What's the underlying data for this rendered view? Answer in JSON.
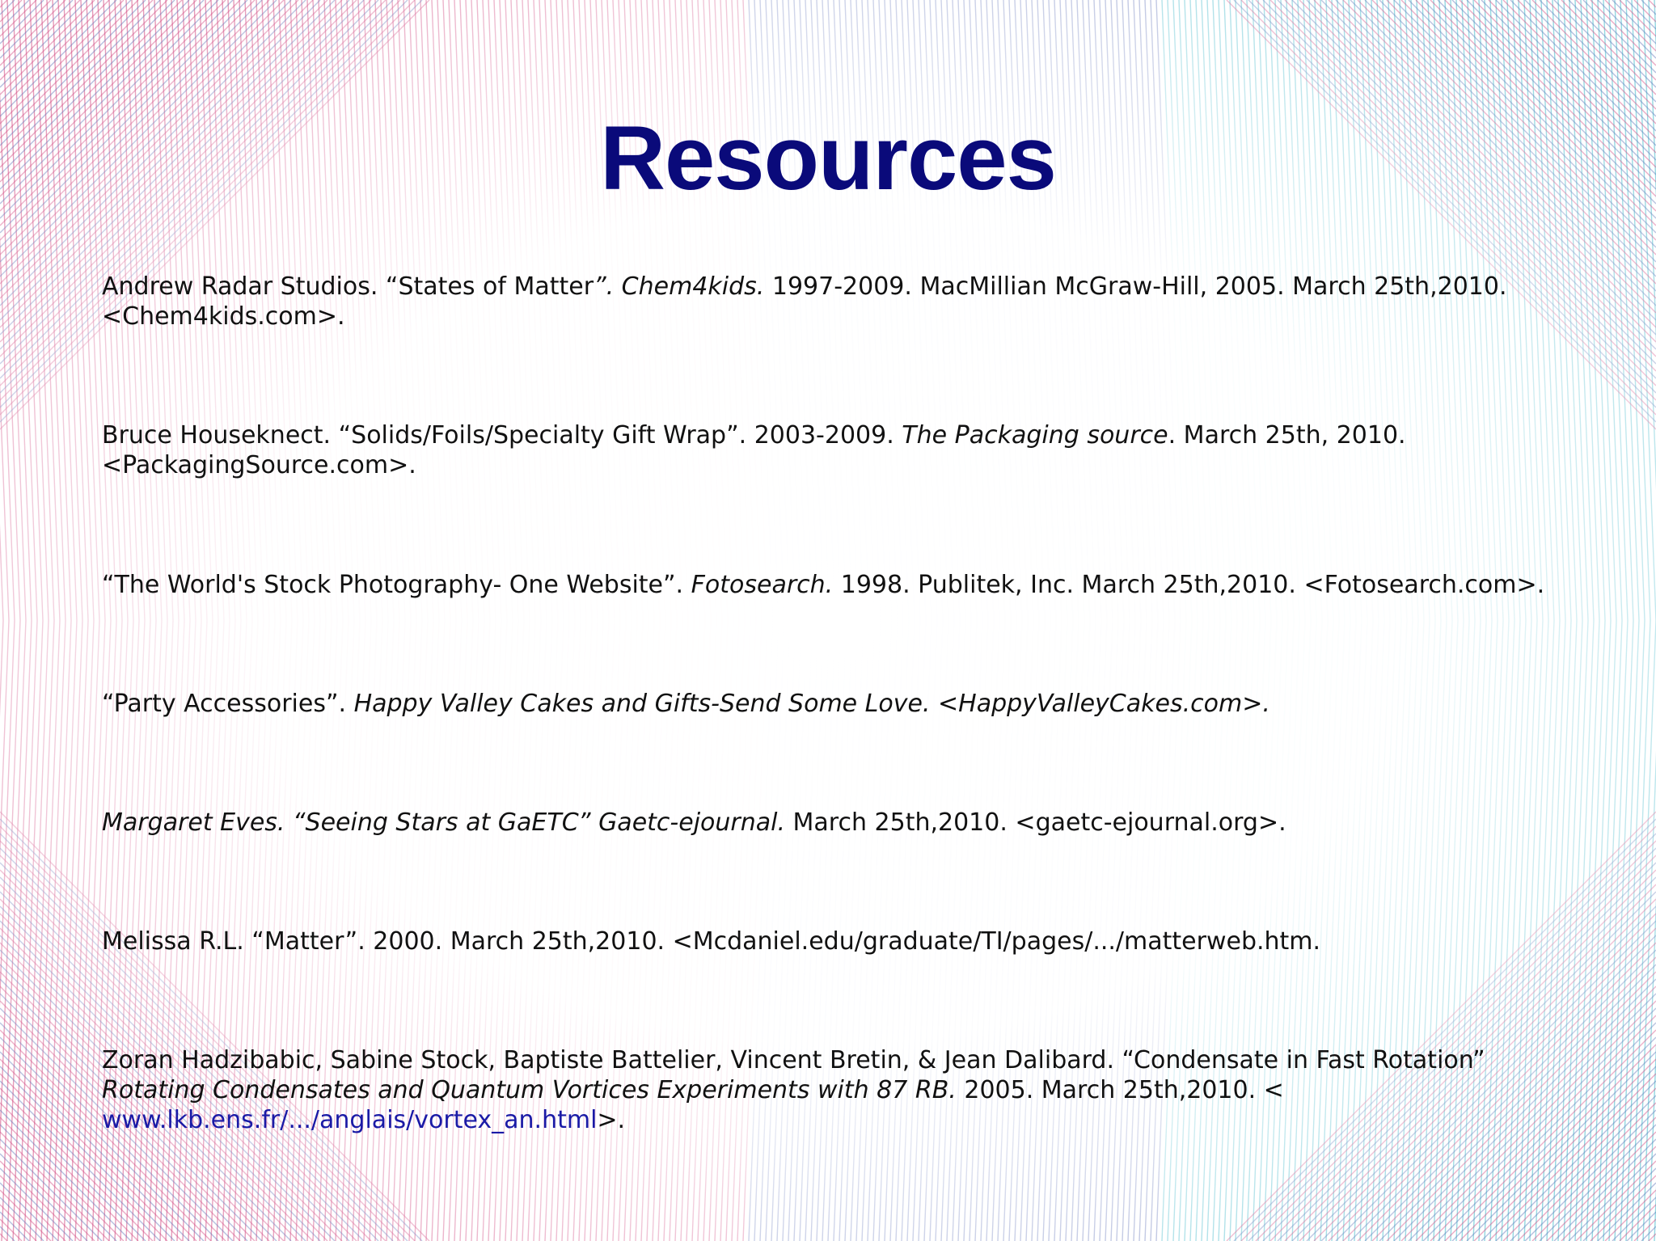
{
  "slide": {
    "title": "Resources",
    "references": [
      {
        "author": "Andrew Radar Studios. “States of Matter",
        "title_italic": "”. Chem4kids.",
        "details": " 1997-2009. MacMillian McGraw-Hill, 2005. March 25th,2010.",
        "url": "<Chem4kids.com>."
      },
      {
        "author": "Bruce Houseknect. “Solids/Foils/Specialty Gift Wrap”. 2003-2009. ",
        "title_italic": "The Packaging source",
        "details": ". March 25th, 2010.",
        "url": "<PackagingSource.com>."
      },
      {
        "author": "“The World's Stock Photography- One Website”. ",
        "title_italic": "Fotosearch.",
        "details": " 1998. Publitek, Inc. March 25th,2010. <Fotosearch.com>."
      },
      {
        "author": "“Party Accessories”. ",
        "title_italic": "Happy Valley Cakes and Gifts-Send Some Love. <HappyValleyCakes.com>."
      },
      {
        "title_italic": "Margaret Eves. “Seeing Stars at GaETC” Gaetc-ejournal.",
        "details": " March 25th,2010. <gaetc-ejournal.org>."
      },
      {
        "author": "Melissa R.L. “Matter”. 2000. March 25th,2010. <Mcdaniel.edu/graduate/TI/pages/.../matterweb.htm."
      },
      {
        "author": "Zoran Hadzibabic, Sabine Stock, Baptiste Battelier, Vincent Bretin, & Jean Dalibard. “Condensate in Fast Rotation”",
        "title_italic": "Rotating Condensates and Quantum Vortices Experiments with 87 RB.",
        "details": " 2005. March 25th,2010. <",
        "link": "www.lkb.ens.fr/.../anglais/vortex_an.html",
        "url": ">."
      }
    ]
  },
  "colors": {
    "title": "#0a0a7a",
    "text": "#111111",
    "link": "#1a1aa6",
    "mesh_pink": "#d0457e",
    "mesh_blue": "#5c6fb6",
    "mesh_cyan": "#3cb7c8"
  }
}
